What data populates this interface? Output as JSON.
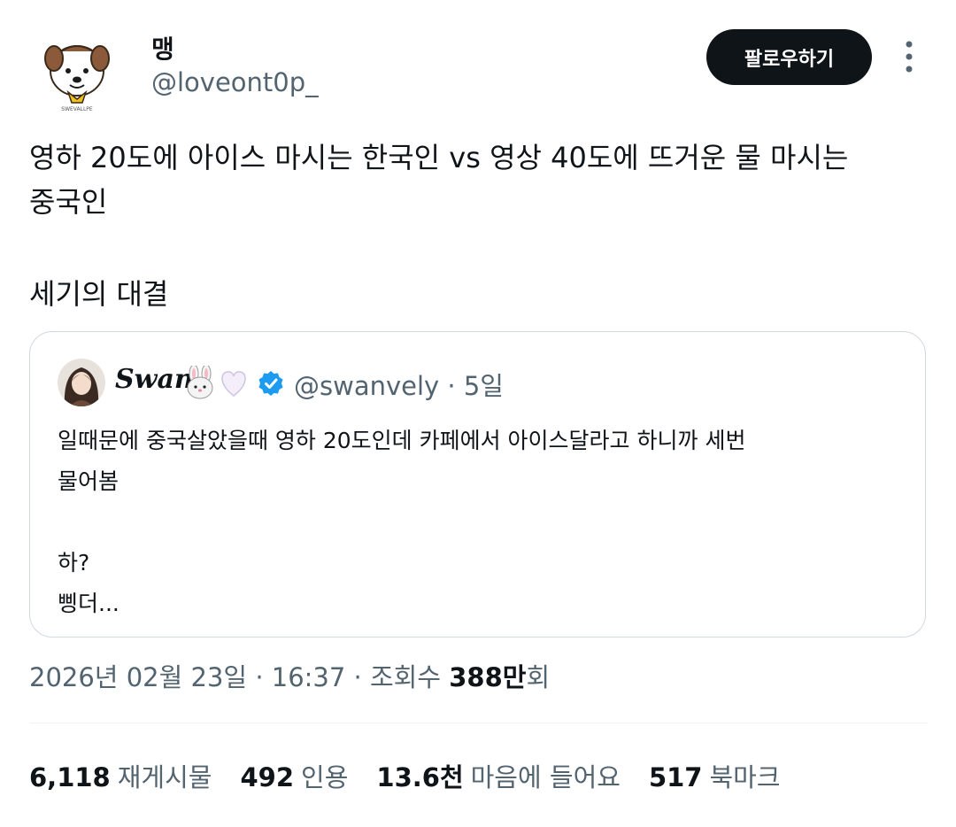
{
  "author": {
    "name": "맹",
    "handle": "@loveont0p_",
    "avatar_icon": "cartoon-dog-avatar-icon",
    "avatar_caption": "SWEVALLPE"
  },
  "follow_button_label": "팔로우하기",
  "more_icon": "more-vertical-icon",
  "tweet_lines": [
    "영하 20도에 아이스 마시는 한국인 vs 영상 40도에 뜨거운 물 마시는",
    "중국인",
    "세기의 대결"
  ],
  "quote": {
    "name": "Swan",
    "emojis": [
      "rabbit-face-icon",
      "white-heart-icon"
    ],
    "verified_icon": "verified-badge-icon",
    "handle": "@swanvely",
    "time": "· 5일",
    "lines": [
      "일때문에 중국살았을때 영하 20도인데 카페에서 아이스달라고 하니까 세번",
      "물어봄",
      "하?",
      "삥더..."
    ]
  },
  "meta": {
    "date": "2026년 02월 23일",
    "sep1": "·",
    "time": "16:37",
    "sep2": "·",
    "views_label": "조회수",
    "views_value": "388만",
    "views_suffix": "회"
  },
  "stats": [
    {
      "value": "6,118",
      "label": "재게시물"
    },
    {
      "value": "492",
      "label": "인용"
    },
    {
      "value": "13.6천",
      "label": "마음에 들어요"
    },
    {
      "value": "517",
      "label": "북마크"
    }
  ],
  "colors": {
    "text_primary": "#0f1419",
    "text_secondary": "#536471",
    "button_bg": "#0f1419",
    "border": "#cfd9de",
    "verified": "#1d9bf0"
  }
}
